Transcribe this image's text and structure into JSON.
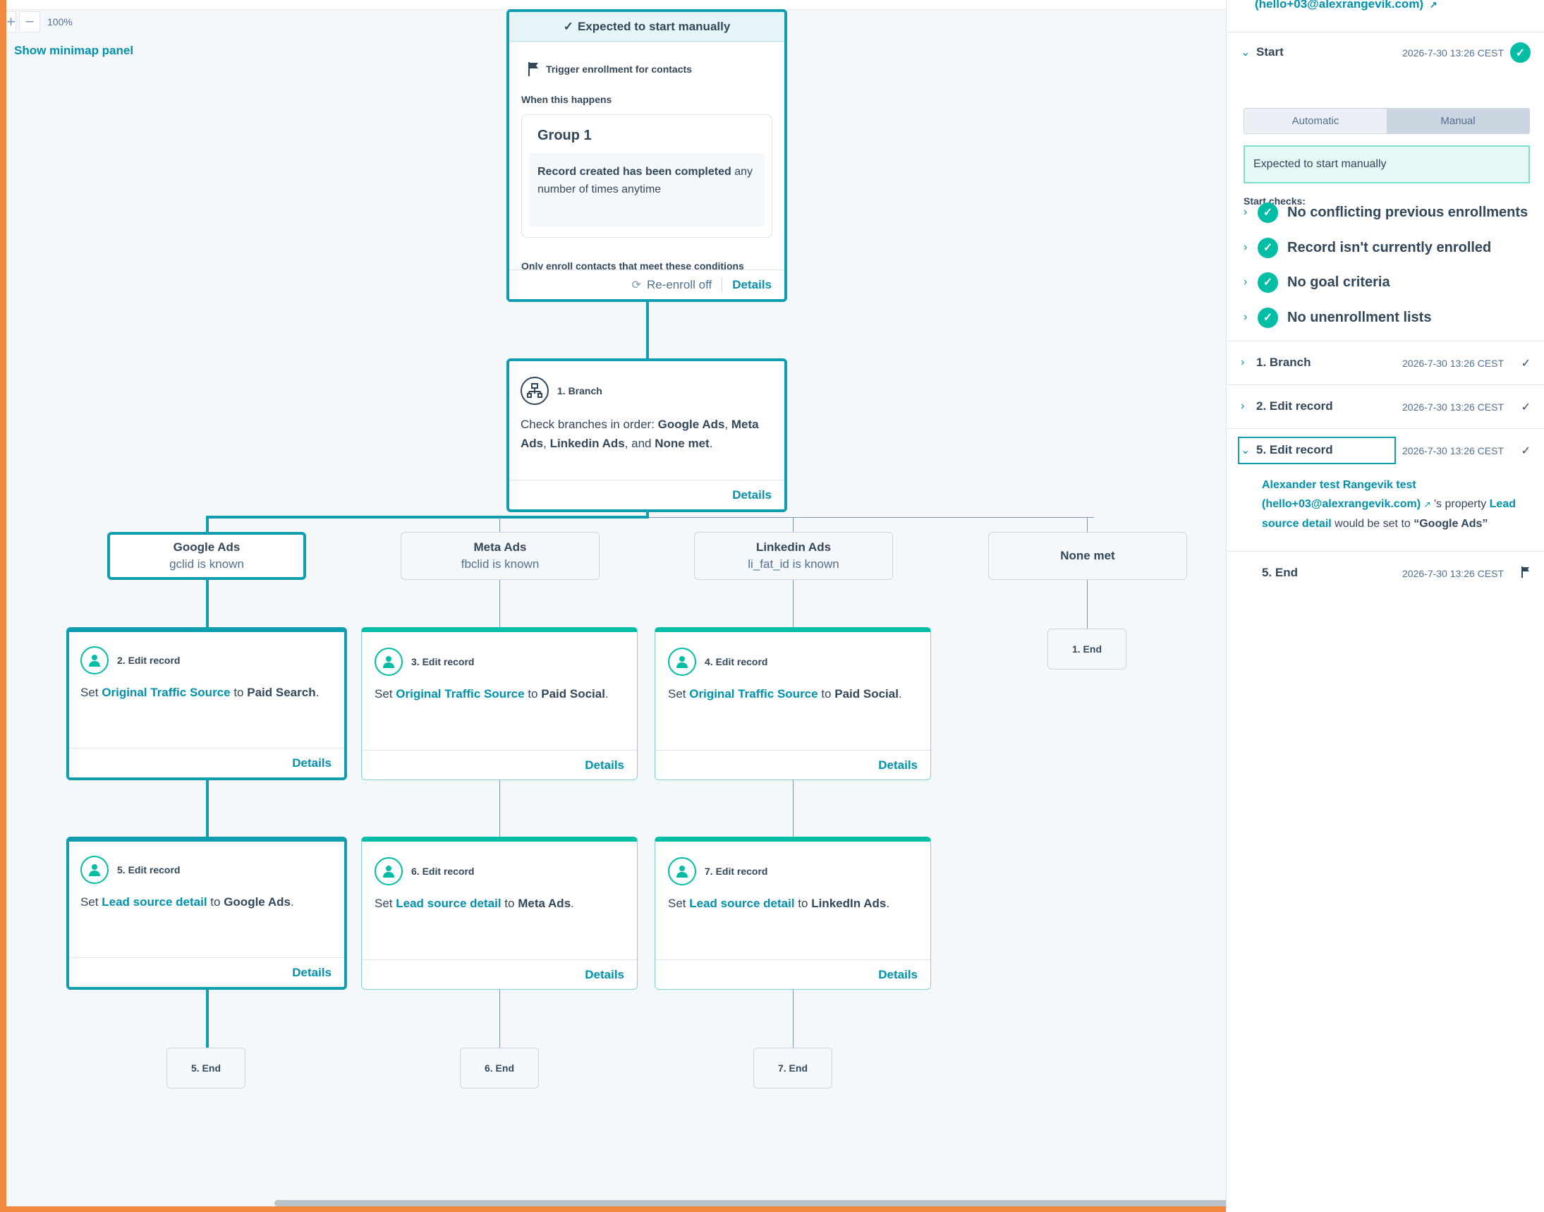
{
  "toolbar": {
    "zoom_in": "+",
    "zoom_out": "−",
    "zoom_level": "100%",
    "minimap_link": "Show minimap panel"
  },
  "trigger": {
    "banner": "Expected to start manually",
    "title": "Trigger enrollment for contacts",
    "when_label": "When this happens",
    "group_title": "Group 1",
    "condition_bold": "Record created has been completed",
    "condition_rest": "any number of times anytime",
    "only_enroll": "Only enroll contacts that meet these conditions",
    "reenroll": "Re-enroll off",
    "details": "Details"
  },
  "branch": {
    "title": "1. Branch",
    "text_pre": "Check branches in order:",
    "b1": "Google Ads",
    "b2": "Meta Ads",
    "b3": "Linkedin Ads",
    "b4": "None met",
    "and": ", and",
    "details": "Details"
  },
  "branches": [
    {
      "title": "Google Ads",
      "sub": "gclid is known"
    },
    {
      "title": "Meta Ads",
      "sub": "fbclid is known"
    },
    {
      "title": "Linkedin Ads",
      "sub": "li_fat_id is known"
    },
    {
      "title": "None met",
      "sub": ""
    }
  ],
  "actions": [
    {
      "title": "2. Edit record",
      "set": "Set",
      "prop": "Original Traffic Source",
      "to": "to",
      "value": "Paid Search",
      "details": "Details"
    },
    {
      "title": "3. Edit record",
      "set": "Set",
      "prop": "Original Traffic Source",
      "to": "to",
      "value": "Paid Social",
      "details": "Details"
    },
    {
      "title": "4. Edit record",
      "set": "Set",
      "prop": "Original Traffic Source",
      "to": "to",
      "value": "Paid Social",
      "details": "Details"
    },
    {
      "title": "5. Edit record",
      "set": "Set",
      "prop": "Lead source detail",
      "to": "to",
      "value": "Google Ads",
      "details": "Details"
    },
    {
      "title": "6. Edit record",
      "set": "Set",
      "prop": "Lead source detail",
      "to": "to",
      "value": "Meta Ads",
      "details": "Details"
    },
    {
      "title": "7. Edit record",
      "set": "Set",
      "prop": "Lead source detail",
      "to": "to",
      "value": "LinkedIn Ads",
      "details": "Details"
    }
  ],
  "ends": [
    "1. End",
    "5. End",
    "6. End",
    "7. End"
  ],
  "panel": {
    "top_link": "(hello+03@alexrangevik.com)",
    "start": {
      "name": "Start",
      "time": "2026-7-30 13:26 CEST"
    },
    "seg_auto": "Automatic",
    "seg_manual": "Manual",
    "notice": "Expected to start manually",
    "checks_label": "Start checks:",
    "checks": [
      "No conflicting previous enrollments",
      "Record isn't currently enrolled",
      "No goal criteria",
      "No unenrollment lists"
    ],
    "rows": [
      {
        "name": "1. Branch",
        "time": "2026-7-30 13:26 CEST"
      },
      {
        "name": "2. Edit record",
        "time": "2026-7-30 13:26 CEST"
      },
      {
        "name": "5. Edit record",
        "time": "2026-7-30 13:26 CEST"
      },
      {
        "name": "5. End",
        "time": "2026-7-30 13:26 CEST"
      }
    ],
    "detail": {
      "contact": "Alexander test Rangevik test (hello+03@alexrangevik.com)",
      "mid": "'s property",
      "prop": "Lead source detail",
      "would": "would be set to",
      "value": "“Google Ads”"
    }
  }
}
